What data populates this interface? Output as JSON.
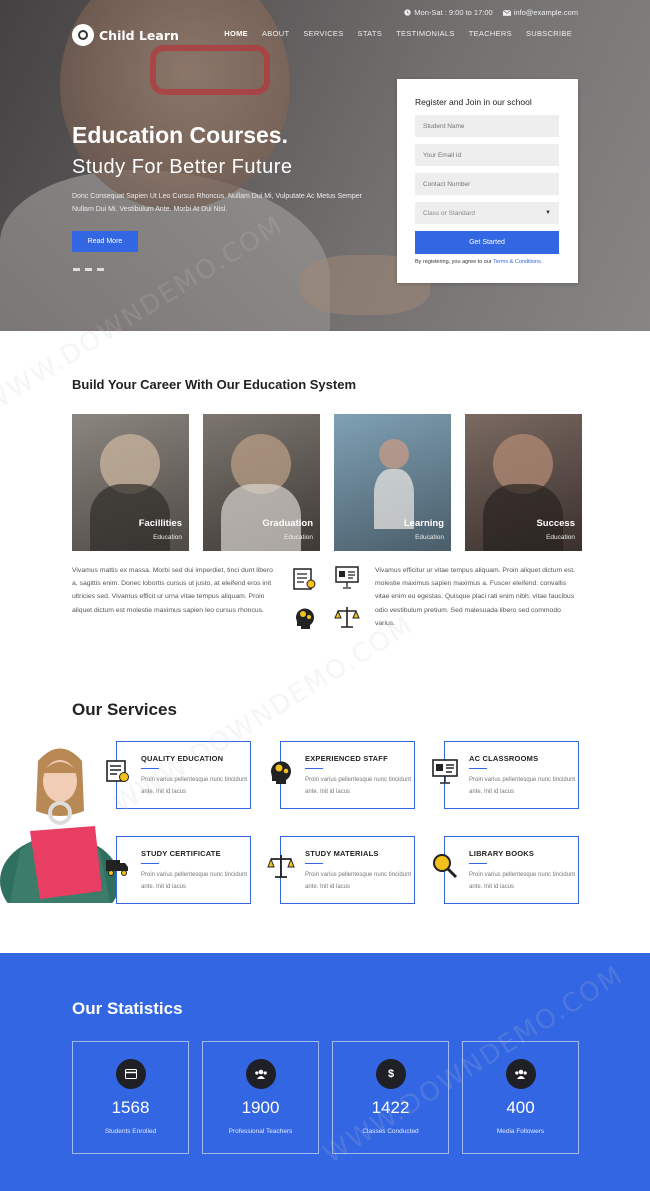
{
  "topbar": {
    "hours": "Mon-Sat : 9:00 to 17:00",
    "email": "info@example.com"
  },
  "brand": {
    "name": "Child Learn"
  },
  "nav": [
    "HOME",
    "ABOUT",
    "SERVICES",
    "STATS",
    "TESTIMONIALS",
    "TEACHERS",
    "SUBSCRIBE"
  ],
  "hero": {
    "title": "Education Courses.",
    "subtitle": "Study For Better Future",
    "text": "Donc Consequat Sapien Ut Leo Cursus Rhoncus. Nullam Dui Mi, Vulputate Ac Metus Semper Nullam Dui Mi. Vestibulum Ante. Morbi At Dui Nisl.",
    "button": "Read More",
    "slides": 3
  },
  "register": {
    "title": "Register and Join in our school",
    "placeholders": [
      "Student Name",
      "Your Email id",
      "Contact Number"
    ],
    "select": "Class or Standard",
    "button": "Get Started",
    "note_prefix": "By registering, you agree to our ",
    "note_link": "Terms & Conditions."
  },
  "career": {
    "title": "Build Your Career With Our Education System",
    "cards": [
      {
        "name": "Facillities",
        "sub": "Education",
        "color": "#6f6a62"
      },
      {
        "name": "Graduation",
        "sub": "Education",
        "color": "#57514c"
      },
      {
        "name": "Learning",
        "sub": "Education",
        "color": "#6a8aa0"
      },
      {
        "name": "Success",
        "sub": "Education",
        "color": "#5c4f49"
      }
    ],
    "text_left": "Vivamus mattis ex massa. Morbi sed dui imperdiet, tinci dunt libero a, sagittis enim. Donec lobortis cursus ut justo, at eleifend eros init ultricies sed. Vivamus efficit ur urna vitae tempus aliquam. Proin aliquet dictum est molestie maximus sapien leo cursus rhoncus.",
    "text_right": "Vivamus efficitur ur vitae tempus aliquam. Proin aliquet dictum est. molestie maximus sapien maximus a. Fuscer eleifend. convallis vitae enim eu egestas. Quisque placi rati enim nibh. vitae faucibus odio vestibulum pretium. Sed malesuada libero sed commodo varius."
  },
  "services": {
    "title": "Our Services",
    "items": [
      {
        "title": "QUALITY EDUCATION",
        "text": "Proin varius pellentesque nunc tincidunt ante. Init id lacus",
        "icon": "certificate-icon"
      },
      {
        "title": "EXPERIENCED STAFF",
        "text": "Proin varius pellentesque nunc tincidunt ante. Init id lacus",
        "icon": "brain-gears-icon"
      },
      {
        "title": "AC CLASSROOMS",
        "text": "Proin varius pellentesque nunc tincidunt ante. Init id lacus",
        "icon": "presentation-board-icon"
      },
      {
        "title": "STUDY CERTIFICATE",
        "text": "Proin varius pellentesque nunc tincidunt ante. Init id lacus",
        "icon": "truck-icon"
      },
      {
        "title": "STUDY MATERIALS",
        "text": "Proin varius pellentesque nunc tincidunt ante. Init id lacus",
        "icon": "scales-icon"
      },
      {
        "title": "LIBRARY BOOKS",
        "text": "Proin varius pellentesque nunc tincidunt ante. Init id lacus",
        "icon": "magnifier-icon"
      }
    ]
  },
  "stats": {
    "title": "Our Statistics",
    "items": [
      {
        "value": "1568",
        "label": "Students Enrolled",
        "icon": "card-icon"
      },
      {
        "value": "1900",
        "label": "Professional Teachers",
        "icon": "users-icon"
      },
      {
        "value": "1422",
        "label": "Classes Conducted",
        "icon": "dollar-icon"
      },
      {
        "value": "400",
        "label": "Media Followers",
        "icon": "users-icon"
      }
    ]
  },
  "colors": {
    "accent": "#3266e3",
    "dark": "#1f1f26"
  },
  "watermark": "WWW.DOWNDEMO.COM"
}
